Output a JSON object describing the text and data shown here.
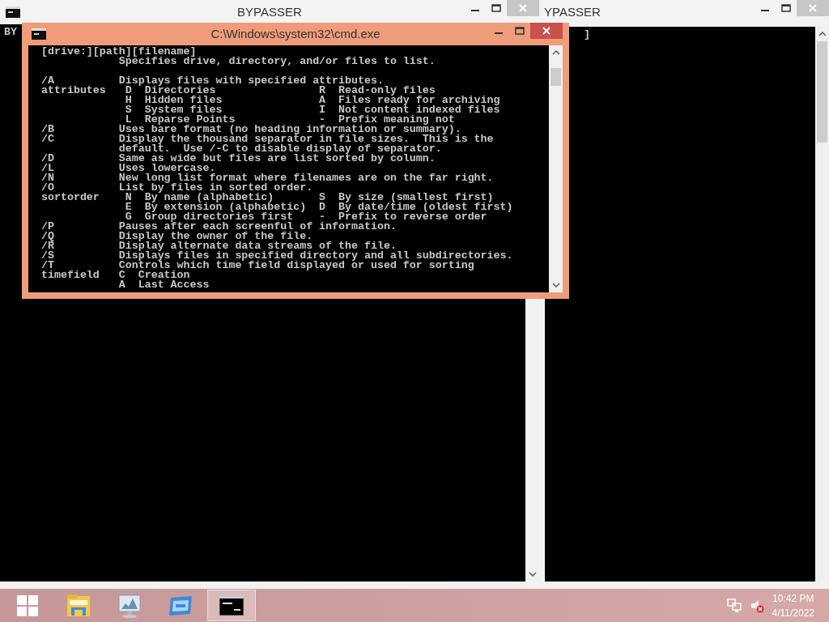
{
  "windows": [
    {
      "title": "BYPASSER",
      "active": false,
      "console": [
        [
          "BY"
        ]
      ]
    },
    {
      "title": "YPASSER",
      "active": false,
      "console": [
        [
          "]"
        ]
      ]
    },
    {
      "title": "C:\\Windows\\system32\\cmd.exe",
      "active": true,
      "console": [
        [
          "[drive:][path][filename]",
          "            Specifies drive, directory, and/or files to list."
        ],
        [
          "/A          Displays files with specified attributes.",
          "attributes   D  Directories                R  Read-only files",
          "             H  Hidden files               A  Files ready for archiving",
          "             S  System files               I  Not content indexed files",
          "             L  Reparse Points             -  Prefix meaning not",
          "/B          Uses bare format (no heading information or summary).",
          "/C          Display the thousand separator in file sizes.  This is the",
          "            default.  Use /-C to disable display of separator.",
          "/D          Same as wide but files are list sorted by column.",
          "/L          Uses lowercase.",
          "/N          New long list format where filenames are on the far right.",
          "/O          List by files in sorted order.",
          "sortorder    N  By name (alphabetic)       S  By size (smallest first)",
          "             E  By extension (alphabetic)  D  By date/time (oldest first)",
          "             G  Group directories first    -  Prefix to reverse order",
          "/P          Pauses after each screenful of information.",
          "/Q          Display the owner of the file.",
          "/R          Display alternate data streams of the file.",
          "/S          Displays files in specified directory and all subdirectories.",
          "/T          Controls which time field displayed or used for sorting",
          "timefield   C  Creation",
          "            A  Last Access"
        ]
      ]
    }
  ],
  "taskbar": {
    "items": [
      {
        "kind": "start",
        "selected": false
      },
      {
        "kind": "folder",
        "selected": false
      },
      {
        "kind": "monitor",
        "selected": false
      },
      {
        "kind": "window",
        "selected": false
      },
      {
        "kind": "console",
        "selected": true
      }
    ],
    "time": "10:42 PM",
    "date": "4/11/2022"
  }
}
